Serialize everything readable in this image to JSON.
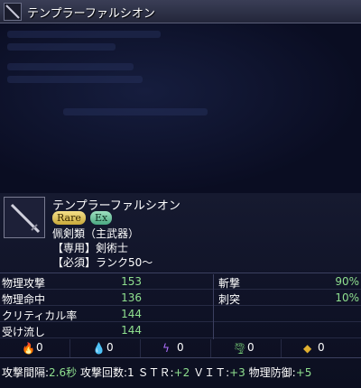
{
  "window": {
    "title": "テンプラーファルシオン"
  },
  "item": {
    "name": "テンプラーファルシオン",
    "badges": {
      "rare": "Rare",
      "ex": "Ex"
    },
    "category": "佩剣類（主武器）",
    "restriction": "【専用】剣術士",
    "requirement": "【必須】ランク50～"
  },
  "stats_left": [
    {
      "label": "物理攻撃",
      "value": "153"
    },
    {
      "label": "物理命中",
      "value": "136"
    },
    {
      "label": "クリティカル率",
      "value": "144"
    },
    {
      "label": "受け流し",
      "value": "144"
    }
  ],
  "stats_right": [
    {
      "label": "斬撃",
      "value": "90%"
    },
    {
      "label": "刺突",
      "value": "10%"
    }
  ],
  "elements": [
    {
      "icon": "fire-icon",
      "glyph": "🔥",
      "value": "0",
      "color": "#ff9a2a"
    },
    {
      "icon": "water-icon",
      "glyph": "💧",
      "value": "0",
      "color": "#3aa0ff"
    },
    {
      "icon": "lightning-icon",
      "glyph": "ϟ",
      "value": "0",
      "color": "#b070ff"
    },
    {
      "icon": "wind-icon",
      "glyph": "🌪",
      "value": "0",
      "color": "#7ad27a"
    },
    {
      "icon": "earth-icon",
      "glyph": "◆",
      "value": "0",
      "color": "#e0b030"
    }
  ],
  "footer": {
    "interval_label": "攻撃間隔:",
    "interval_value": "2.6秒",
    "count_label": "攻撃回数:",
    "count_value": "1",
    "str_label": "ＳＴＲ:",
    "str_value": "+2",
    "vit_label": "ＶＩＴ:",
    "vit_value": "+3",
    "pdef_label": "物理防御:",
    "pdef_value": "+5"
  }
}
